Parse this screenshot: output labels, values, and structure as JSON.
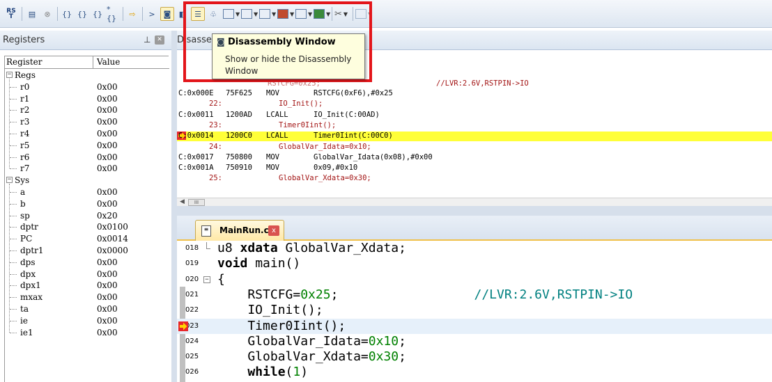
{
  "toolbar": {
    "rst_label_top": "RS",
    "rst_label_bottom": "T",
    "buttons": [
      "reset",
      "run",
      "stop",
      "step-into",
      "step-over",
      "step-out",
      "run-to-cursor",
      "show-next-statement",
      "command-window",
      "disassembly-window",
      "symbols-window",
      "registers-window",
      "call-stack-window",
      "watch-window",
      "memory-window",
      "serial-window",
      "analysis-window",
      "trace-window",
      "system-viewer",
      "toolbox",
      "debug-restore"
    ]
  },
  "registers": {
    "title": "Registers",
    "col_register": "Register",
    "col_value": "Value",
    "groups": [
      {
        "name": "Regs",
        "expander": "−",
        "items": [
          {
            "name": "r0",
            "value": "0x00"
          },
          {
            "name": "r1",
            "value": "0x00"
          },
          {
            "name": "r2",
            "value": "0x00"
          },
          {
            "name": "r3",
            "value": "0x00"
          },
          {
            "name": "r4",
            "value": "0x00"
          },
          {
            "name": "r5",
            "value": "0x00"
          },
          {
            "name": "r6",
            "value": "0x00"
          },
          {
            "name": "r7",
            "value": "0x00"
          }
        ]
      },
      {
        "name": "Sys",
        "expander": "−",
        "items": [
          {
            "name": "a",
            "value": "0x00"
          },
          {
            "name": "b",
            "value": "0x00"
          },
          {
            "name": "sp",
            "value": "0x20"
          },
          {
            "name": "dptr",
            "value": "0x0100"
          },
          {
            "name": "PC",
            "value": "0x0014"
          },
          {
            "name": "dptr1",
            "value": "0x0000"
          },
          {
            "name": "dps",
            "value": "0x00"
          },
          {
            "name": "dpx",
            "value": "0x00"
          },
          {
            "name": "dpx1",
            "value": "0x00"
          },
          {
            "name": "mxax",
            "value": "0x00"
          },
          {
            "name": "ta",
            "value": "0x00"
          },
          {
            "name": "ie",
            "value": "0x00"
          },
          {
            "name": "ie1",
            "value": "0x00"
          }
        ]
      }
    ]
  },
  "disassembly": {
    "title": "Disasse",
    "partial_line": "RSTCFG=0x25;",
    "partial_comment": "//LVR:2.6V,RSTPIN->IO",
    "lines": [
      {
        "kind": "asm",
        "addr": "C:0x000E",
        "code": "75F625",
        "mnem": "MOV",
        "ops": "RSTCFG(0xF6),#0x25"
      },
      {
        "kind": "src",
        "num": "22:",
        "text": "IO_Init();"
      },
      {
        "kind": "asm",
        "addr": "C:0x0011",
        "code": "1200AD",
        "mnem": "LCALL",
        "ops": "IO_Init(C:00AD)"
      },
      {
        "kind": "src",
        "num": "23:",
        "text": "Timer0Iint();"
      },
      {
        "kind": "asm",
        "addr": "C:0x0014",
        "code": "1200C0",
        "mnem": "LCALL",
        "ops": "Timer0Iint(C:00C0)",
        "current": true
      },
      {
        "kind": "src",
        "num": "24:",
        "text": "GlobalVar_Idata=0x10;"
      },
      {
        "kind": "asm",
        "addr": "C:0x0017",
        "code": "750800",
        "mnem": "MOV",
        "ops": "GlobalVar_Idata(0x08),#0x00"
      },
      {
        "kind": "asm",
        "addr": "C:0x001A",
        "code": "750910",
        "mnem": "MOV",
        "ops": "0x09,#0x10"
      },
      {
        "kind": "src",
        "num": "25:",
        "text": "GlobalVar_Xdata=0x30;"
      }
    ],
    "scroll_thumb": "III"
  },
  "tooltip": {
    "title": "Disassembly Window",
    "body": "Show or hide the Disassembly Window"
  },
  "editor": {
    "tab_label": "MainRun.c",
    "tab_close": "x",
    "lines": [
      {
        "num": "018",
        "parts": [
          [
            "",
            "u8 "
          ],
          [
            "kw",
            "xdata"
          ],
          [
            "",
            " GlobalVar_Xdata;"
          ]
        ]
      },
      {
        "num": "019",
        "parts": [
          [
            "kw",
            "void"
          ],
          [
            "",
            " main()"
          ]
        ]
      },
      {
        "num": "020",
        "parts": [
          [
            "",
            "{"
          ]
        ]
      },
      {
        "num": "021",
        "parts": [
          [
            "",
            "    RSTCFG="
          ],
          [
            "num",
            "0x25"
          ],
          [
            "",
            ";                  "
          ],
          [
            "ecmt",
            "//LVR:2.6V,RSTPIN->IO"
          ]
        ]
      },
      {
        "num": "022",
        "parts": [
          [
            "",
            "    IO_Init();"
          ]
        ]
      },
      {
        "num": "023",
        "parts": [
          [
            "",
            "    Timer0Iint();"
          ]
        ],
        "current": true
      },
      {
        "num": "024",
        "parts": [
          [
            "",
            "    GlobalVar_Idata="
          ],
          [
            "num",
            "0x10"
          ],
          [
            "",
            ";"
          ]
        ]
      },
      {
        "num": "025",
        "parts": [
          [
            "",
            "    GlobalVar_Xdata="
          ],
          [
            "num",
            "0x30"
          ],
          [
            "",
            ";"
          ]
        ]
      },
      {
        "num": "026",
        "parts": [
          [
            "",
            "    "
          ],
          [
            "kw",
            "while"
          ],
          [
            "",
            "("
          ],
          [
            "num",
            "1"
          ],
          [
            "",
            ")"
          ]
        ]
      }
    ]
  },
  "colors": {
    "current_line": "#ffff38",
    "editor_current_line": "#e6f0fa",
    "highlight_box": "#e3151a",
    "source_text": "#a31515"
  }
}
